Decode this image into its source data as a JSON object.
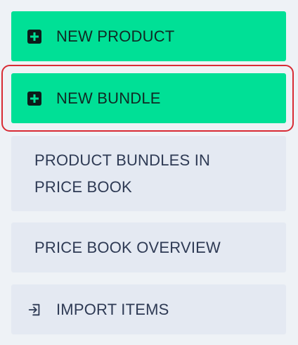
{
  "menu": {
    "items": [
      {
        "label": "NEW PRODUCT",
        "icon": "plus-square-icon",
        "variant": "primary"
      },
      {
        "label": "NEW BUNDLE",
        "icon": "plus-square-icon",
        "variant": "primary",
        "highlighted": true
      },
      {
        "label": "PRODUCT BUNDLES IN PRICE BOOK",
        "variant": "secondary"
      },
      {
        "label": "PRICE BOOK OVERVIEW",
        "variant": "secondary"
      },
      {
        "label": "IMPORT ITEMS",
        "icon": "import-icon",
        "variant": "secondary"
      }
    ]
  },
  "colors": {
    "primary": "#00e096",
    "secondary": "#e4e9f2",
    "background": "#eef2f6",
    "highlight": "#d82b34",
    "text": "#2e3a54"
  }
}
